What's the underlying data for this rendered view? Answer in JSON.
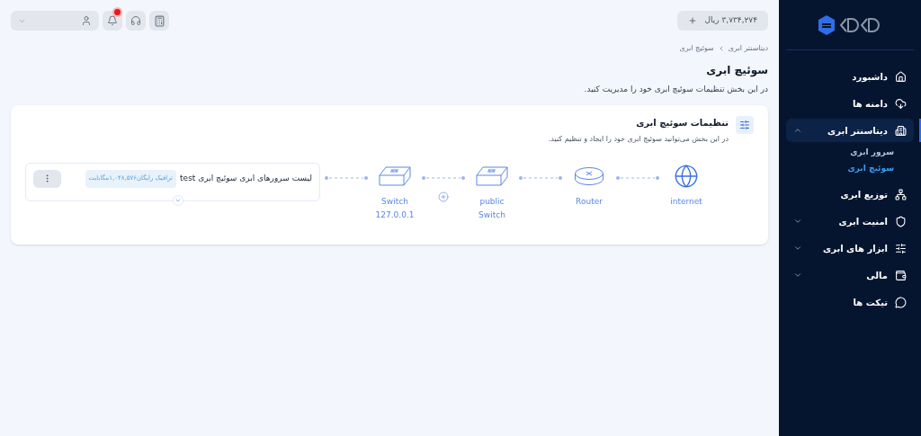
{
  "topbar": {
    "balance": "۳,۷۳۴,۲۷۴ ریال",
    "notifications_unread": true
  },
  "breadcrumb": [
    "دیتاسنتر ابری",
    "سوئیچ ابری"
  ],
  "page": {
    "title": "سوئیچ ابری",
    "description": "در این بخش تنظیمات سوئیچ ابری خود را مدیریت کنید."
  },
  "card": {
    "title": "تنظیمات سوئیچ ابری",
    "description": "در این بخش می‌توانید سوئیچ ابری خود را ایجاد و تنظیم کنید.",
    "nodes": [
      {
        "kind": "globe",
        "label": "internet"
      },
      {
        "kind": "router",
        "label": "Router"
      },
      {
        "kind": "switch",
        "label": "public Switch"
      },
      {
        "kind": "switch",
        "label": "Switch",
        "address": "127.0.0.1"
      }
    ],
    "server_list": {
      "title": "لیست سرورهای ابری سوئیچ ابری test",
      "badge": "ترافیک رایگان۱,۰۴۸,۵۷۶مگابایت"
    }
  },
  "sidebar": {
    "items": [
      {
        "label": "داشبورد",
        "selected": false
      },
      {
        "label": "دامنه ها",
        "selected": false
      },
      {
        "label": "دیتاسنتر ابری",
        "selected": true,
        "expanded": true,
        "children": [
          {
            "label": "سرور ابری",
            "selected": false
          },
          {
            "label": "سوئیچ ابری",
            "selected": true
          }
        ]
      },
      {
        "label": "توزیع ابری",
        "selected": false
      },
      {
        "label": "امنیت ابری",
        "selected": false,
        "expanded": false
      },
      {
        "label": "ابزار های ابری",
        "selected": false,
        "expanded": false
      },
      {
        "label": "مالی",
        "selected": false,
        "expanded": false
      },
      {
        "label": "تیکت ها",
        "selected": false
      }
    ]
  }
}
